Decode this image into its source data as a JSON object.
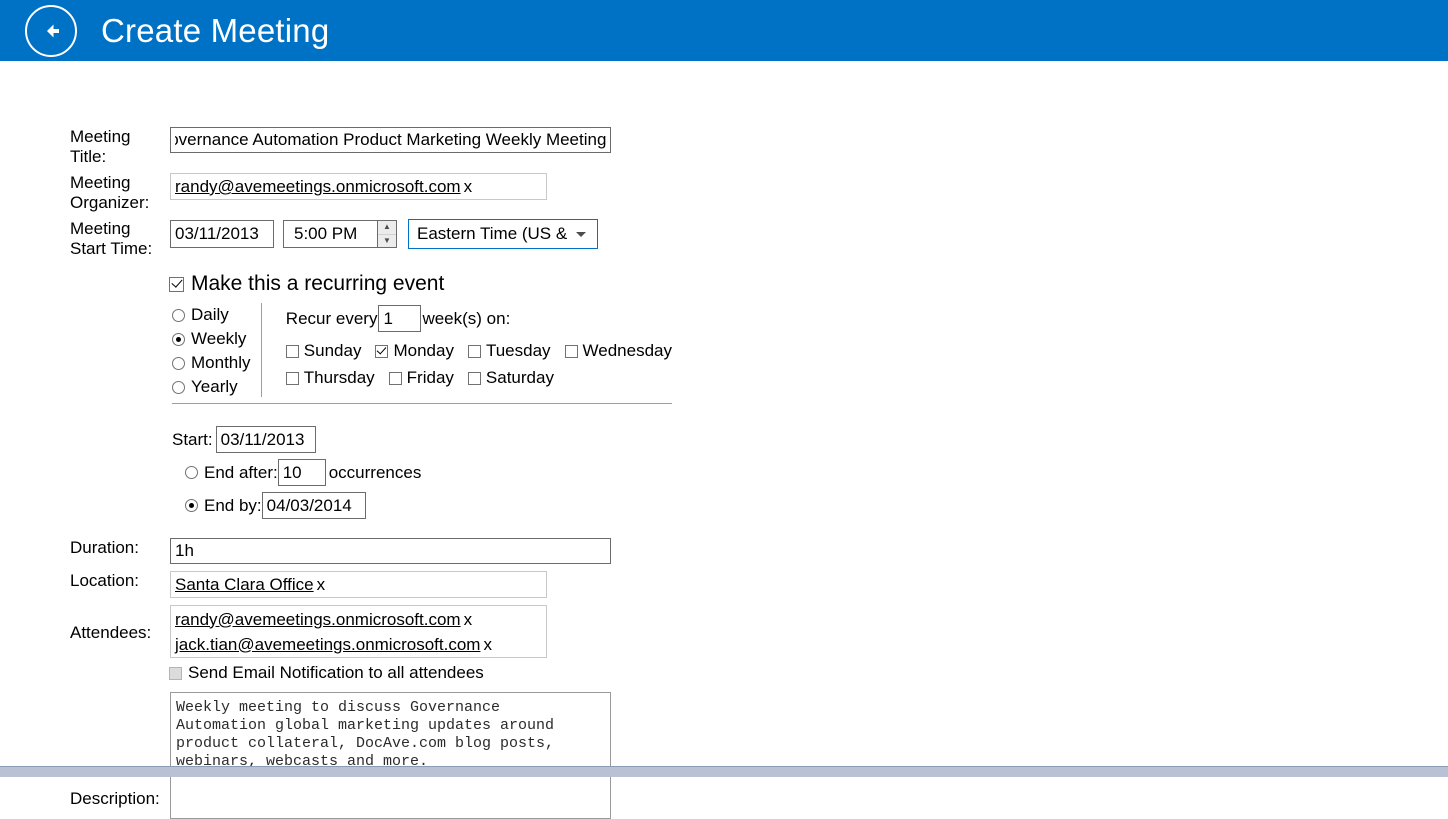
{
  "header": {
    "title": "Create Meeting",
    "back_icon": "arrow-left-circle-icon",
    "background": "#0072c6"
  },
  "form": {
    "meeting_title": {
      "label": "Meeting Title:",
      "value": "Governance Automation Product Marketing Weekly Meeting"
    },
    "meeting_organizer": {
      "label": "Meeting Organizer:",
      "tokens": [
        {
          "address": "randy@avemeetings.onmicrosoft.com",
          "remove": "x"
        }
      ]
    },
    "meeting_start_time": {
      "label": "Meeting Start Time:",
      "date": "03/11/2013",
      "time": "5:00 PM",
      "timezone": "Eastern Time (US &",
      "spinner_up_icon": "chevron-up-icon",
      "spinner_down_icon": "chevron-down-icon",
      "dropdown_icon": "chevron-down-icon",
      "focus_color": "#0073c8"
    },
    "recurring": {
      "label": "Make this a recurring event",
      "checked": true,
      "frequency_options": [
        {
          "label": "Daily",
          "selected": false
        },
        {
          "label": "Weekly",
          "selected": true
        },
        {
          "label": "Monthly",
          "selected": false
        },
        {
          "label": "Yearly",
          "selected": false
        }
      ],
      "recur_every_prefix": "Recur every",
      "interval": "1",
      "recur_every_suffix": "week(s) on:",
      "days": [
        {
          "label": "Sunday",
          "checked": false
        },
        {
          "label": "Monday",
          "checked": true
        },
        {
          "label": "Tuesday",
          "checked": false
        },
        {
          "label": "Wednesday",
          "checked": false
        },
        {
          "label": "Thursday",
          "checked": false
        },
        {
          "label": "Friday",
          "checked": false
        },
        {
          "label": "Saturday",
          "checked": false
        }
      ],
      "range": {
        "start_label": "Start:",
        "start_value": "03/11/2013",
        "end_after_label": "End after:",
        "end_after_value": "10",
        "occurrences_label": "occurrences",
        "end_after_selected": false,
        "end_by_label": "End by:",
        "end_by_value": "04/03/2014",
        "end_by_selected": true
      }
    },
    "duration": {
      "label": "Duration:",
      "value": "1h"
    },
    "location": {
      "label": "Location:",
      "tokens": [
        {
          "address": "Santa Clara Office",
          "remove": "x"
        }
      ]
    },
    "attendees": {
      "label": "Attendees:",
      "tokens": [
        {
          "address": "randy@avemeetings.onmicrosoft.com",
          "remove": "x"
        },
        {
          "address": "jack.tian@avemeetings.onmicrosoft.com",
          "remove": "x"
        }
      ]
    },
    "send_email": {
      "label": "Send Email Notification to all attendees",
      "checked": false,
      "disabled": true
    },
    "description": {
      "label": "Description:",
      "value": "Weekly meeting to discuss Governance\nAutomation global marketing updates around\nproduct collateral, DocAve.com blog posts,\nwebinars, webcasts and more."
    }
  }
}
